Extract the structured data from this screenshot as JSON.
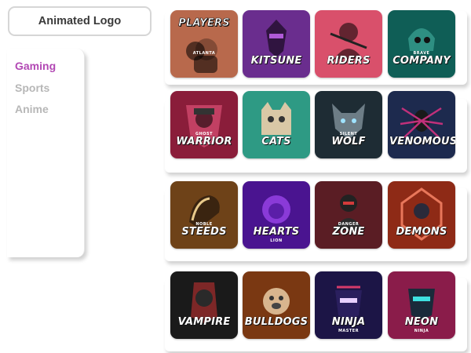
{
  "header": {
    "button_label": "Animated Logo"
  },
  "sidebar": {
    "items": [
      {
        "label": "Gaming",
        "active": true
      },
      {
        "label": "Sports",
        "active": false
      },
      {
        "label": "Anime",
        "active": false
      }
    ],
    "colors": {
      "active": "#b248b4",
      "inactive": "#b7b7b7"
    }
  },
  "gallery": {
    "rows": [
      {
        "tiles": [
          {
            "name": "players",
            "bg": "#b8694c",
            "icon": "football-player-icon",
            "top_text": "PLAYERS",
            "small_text": "ATLANTA",
            "main_text": "",
            "sub_text": ""
          },
          {
            "name": "kitsune",
            "bg": "#6a2d8e",
            "icon": "kitsune-ninja-icon",
            "top_text": "",
            "small_text": "",
            "main_text": "KITSUNE",
            "sub_text": ""
          },
          {
            "name": "riders",
            "bg": "#d9506b",
            "icon": "rider-woman-icon",
            "top_text": "",
            "small_text": "",
            "main_text": "RIDERS",
            "sub_text": ""
          },
          {
            "name": "company",
            "bg": "#0f5e56",
            "icon": "skull-helmet-icon",
            "top_text": "",
            "small_text": "BRAVE",
            "main_text": "COMPANY",
            "sub_text": ""
          }
        ]
      },
      {
        "tiles": [
          {
            "name": "warrior",
            "bg": "#8a1d3a",
            "icon": "warrior-cap-icon",
            "top_text": "",
            "small_text": "GHOST",
            "main_text": "WARRIOR",
            "sub_text": ""
          },
          {
            "name": "cats",
            "bg": "#2e9a84",
            "icon": "grumpy-cat-icon",
            "top_text": "",
            "small_text": "",
            "main_text": "CATS",
            "sub_text": ""
          },
          {
            "name": "wolf",
            "bg": "#1e2c34",
            "icon": "wolf-head-icon",
            "top_text": "",
            "small_text": "SILENT",
            "main_text": "WOLF",
            "sub_text": ""
          },
          {
            "name": "venomous",
            "bg": "#1d2a4e",
            "icon": "spider-icon",
            "top_text": "",
            "small_text": "",
            "main_text": "VENOMOUS",
            "sub_text": ""
          }
        ]
      },
      {
        "tiles": [
          {
            "name": "steeds",
            "bg": "#6e4218",
            "icon": "horse-head-icon",
            "top_text": "",
            "small_text": "NOBLE",
            "main_text": "STEEDS",
            "sub_text": ""
          },
          {
            "name": "lion-hearts",
            "bg": "#4a1490",
            "icon": "lion-head-icon",
            "top_text": "",
            "small_text": "",
            "main_text": "HEARTS",
            "sub_text": "LION"
          },
          {
            "name": "zone",
            "bg": "#5a1d24",
            "icon": "soldier-icon",
            "top_text": "",
            "small_text": "DANGER",
            "main_text": "ZONE",
            "sub_text": ""
          },
          {
            "name": "demons",
            "bg": "#8e2a16",
            "icon": "demon-icon",
            "top_text": "",
            "small_text": "",
            "main_text": "DEMONS",
            "sub_text": ""
          }
        ]
      },
      {
        "tiles": [
          {
            "name": "vampire",
            "bg": "#1a1a1a",
            "icon": "vampire-icon",
            "top_text": "",
            "small_text": "",
            "main_text": "VAMPIRE",
            "sub_text": ""
          },
          {
            "name": "bulldogs",
            "bg": "#7a3812",
            "icon": "bulldog-icon",
            "top_text": "",
            "small_text": "",
            "main_text": "BULLDOGS",
            "sub_text": ""
          },
          {
            "name": "ninja",
            "bg": "#1c1546",
            "icon": "ninja-icon",
            "top_text": "",
            "small_text": "",
            "main_text": "NINJA",
            "sub_text": "MASTER"
          },
          {
            "name": "neon",
            "bg": "#8a1c4a",
            "icon": "neon-ninja-icon",
            "top_text": "",
            "small_text": "",
            "main_text": "NEON",
            "sub_text": "NINJA"
          }
        ]
      }
    ]
  }
}
